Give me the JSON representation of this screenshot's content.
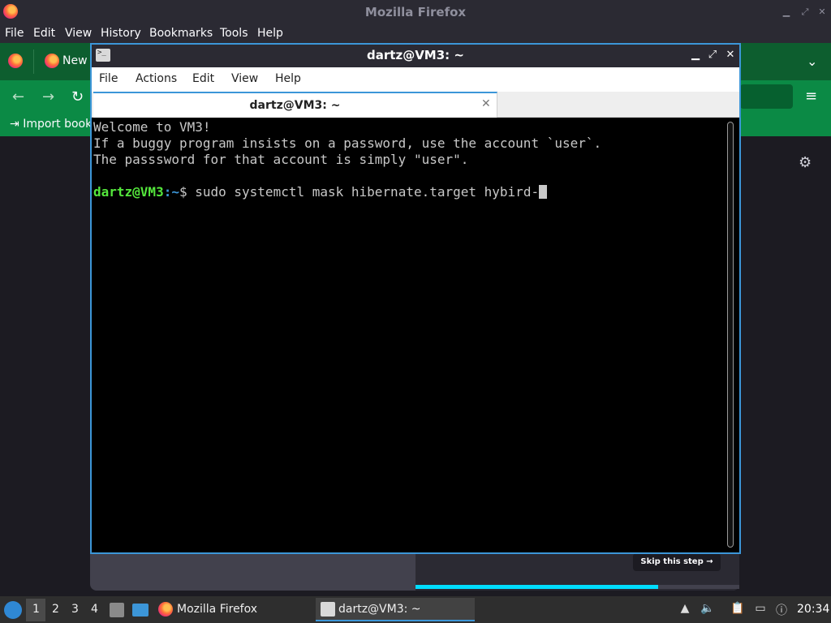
{
  "firefox": {
    "window_title": "Mozilla Firefox",
    "menu": [
      "File",
      "Edit",
      "View",
      "History",
      "Bookmarks",
      "Tools",
      "Help"
    ],
    "tab_label": "New",
    "bookmark_label": "Import book",
    "onboarding": {
      "skip_label": "Skip this step →",
      "progress": 0.75
    }
  },
  "terminal": {
    "window_title": "dartz@VM3: ~",
    "menu": [
      "File",
      "Actions",
      "Edit",
      "View",
      "Help"
    ],
    "tab_title": "dartz@VM3: ~",
    "lines": [
      "Welcome to VM3!",
      "If a buggy program insists on a password, use the account `user`.",
      "The passsword for that account is simply \"user\"."
    ],
    "prompt_user": "dartz@VM3",
    "prompt_path": ":~",
    "prompt_symbol": "$ ",
    "command": "sudo systemctl mask hibernate.target hybird-"
  },
  "taskbar": {
    "workspaces": [
      "1",
      "2",
      "3",
      "4"
    ],
    "tasks": [
      {
        "label": "Mozilla Firefox"
      },
      {
        "label": "dartz@VM3: ~"
      }
    ],
    "clock": "20:34"
  },
  "colors": {
    "firefox_tabbar": "#0d5e2f",
    "firefox_toolbar": "#0b8a45",
    "terminal_border": "#3c96d8",
    "prompt_user": "#54e63c",
    "prompt_path": "#3c96d8"
  }
}
